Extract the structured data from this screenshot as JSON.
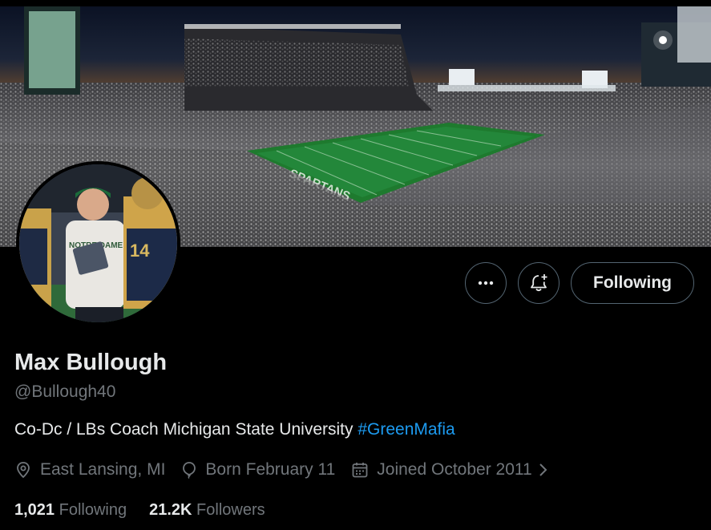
{
  "profile": {
    "name": "Max Bullough",
    "handle": "@Bullough40",
    "bio_text": "Co-Dc / LBs Coach Michigan State University ",
    "bio_hashtag": "#GreenMafia",
    "location": "East Lansing, MI",
    "birthday": "Born February 11",
    "joined": "Joined October 2011",
    "following_count": "1,021",
    "following_label": "Following",
    "followers_count": "21.2K",
    "followers_label": "Followers"
  },
  "actions": {
    "more_icon": "more-icon",
    "notify_icon": "bell-plus-icon",
    "follow_label": "Following"
  },
  "colors": {
    "background": "#000000",
    "text_primary": "#e7e9ea",
    "text_secondary": "#71767b",
    "link": "#1d9bf0",
    "border": "#536471"
  }
}
